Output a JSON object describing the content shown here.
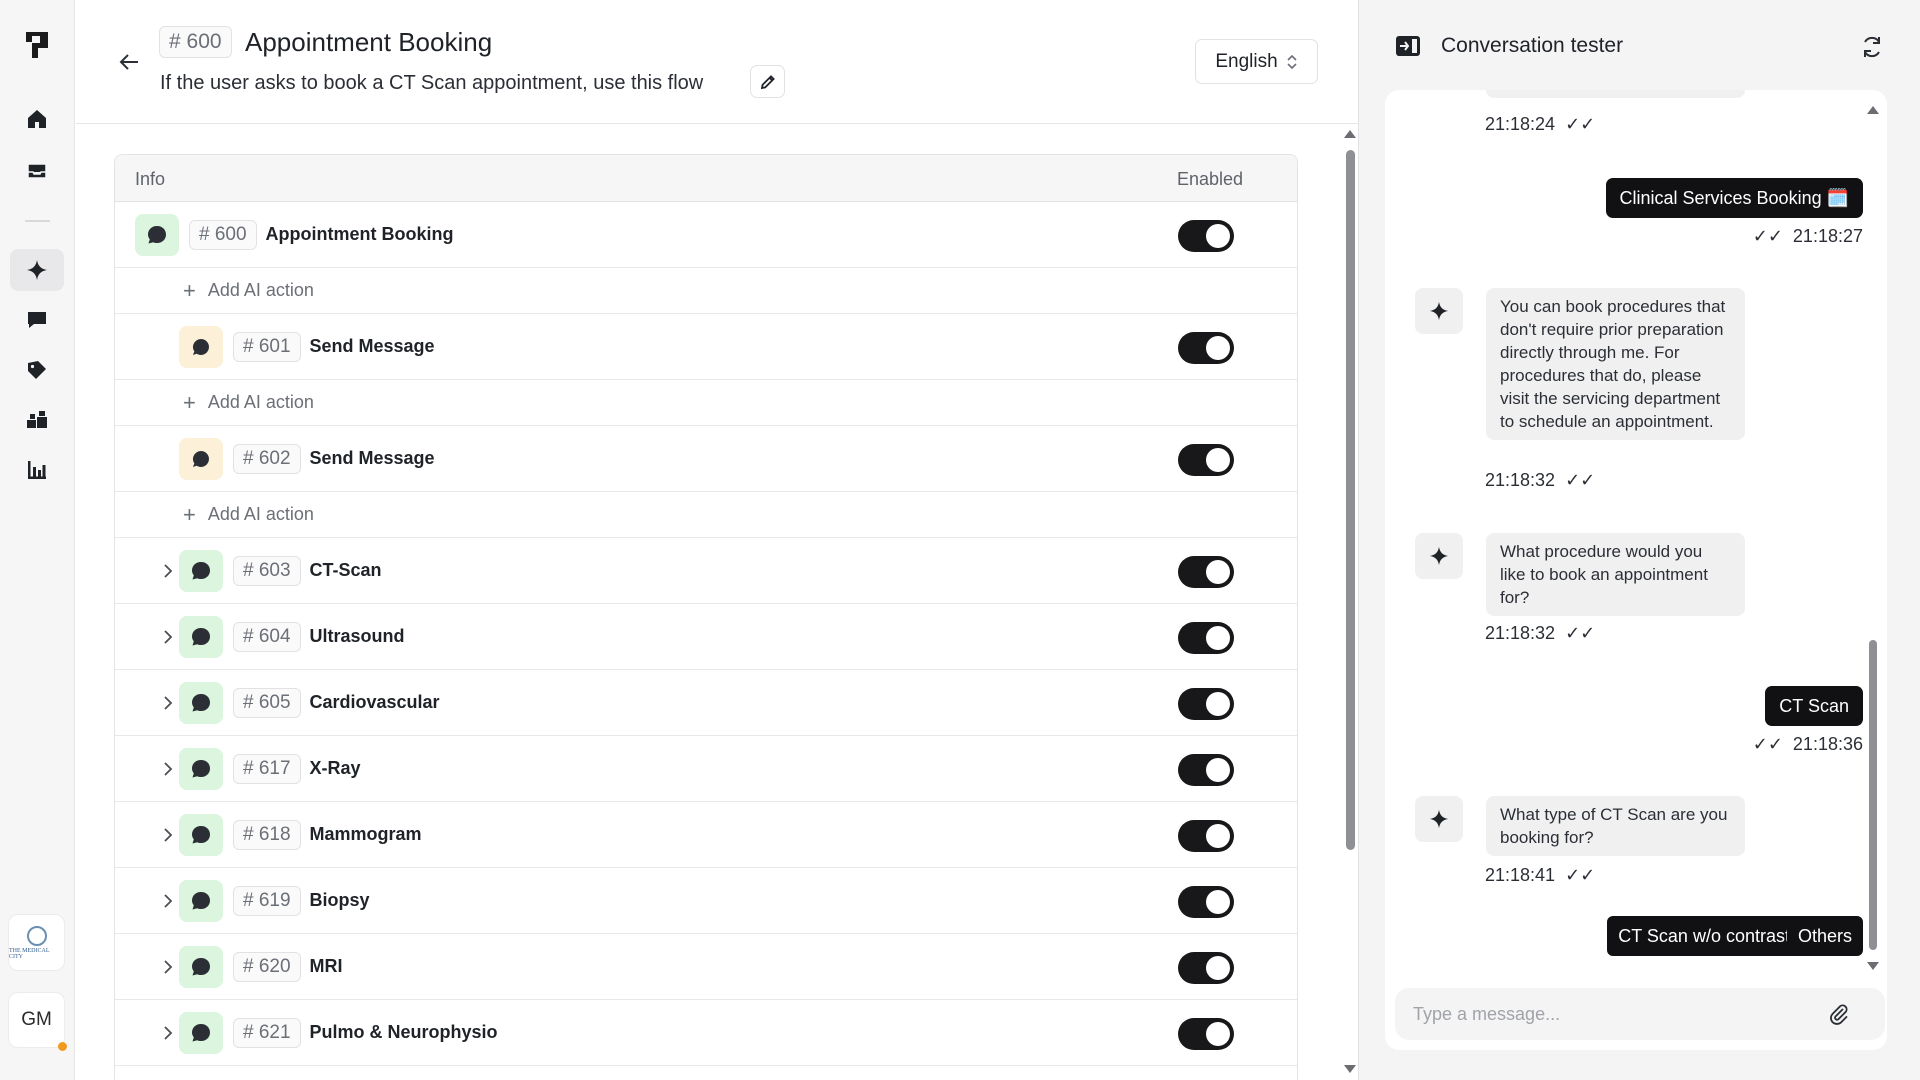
{
  "colors": {
    "accent": "#18181b",
    "green_tint": "#dcf5df",
    "amber_tint": "#fdf0d9",
    "status_dot": "#f29a1f"
  },
  "rail": {
    "items": [
      {
        "name": "home",
        "icon": "home-icon"
      },
      {
        "name": "inbox",
        "icon": "inbox-icon"
      },
      {
        "name": "ai-flows",
        "icon": "sparkle-icon",
        "active": true
      },
      {
        "name": "conversations",
        "icon": "chat-icon"
      },
      {
        "name": "tickets",
        "icon": "tag-icon"
      },
      {
        "name": "contacts",
        "icon": "users-icon"
      },
      {
        "name": "reports",
        "icon": "bar-chart-icon"
      }
    ],
    "org_label": "THE MEDICAL CITY",
    "avatar_initials": "GM"
  },
  "header": {
    "id": "# 600",
    "title": "Appointment Booking",
    "subtitle": "If the user asks to book a CT Scan appointment, use this flow",
    "language": "English"
  },
  "table": {
    "col_info": "Info",
    "col_enabled": "Enabled",
    "add_action_label": "Add AI action",
    "rows": [
      {
        "kind": "flow",
        "id": "# 600",
        "name": "Appointment Booking",
        "icon": "chat-bubble-icon",
        "tint": "green",
        "expandable": false,
        "indent": 0,
        "enabled": true
      },
      {
        "kind": "add"
      },
      {
        "kind": "flow",
        "id": "# 601",
        "name": "Send Message",
        "icon": "message-dot-icon",
        "tint": "amber",
        "expandable": false,
        "indent": 1,
        "enabled": true
      },
      {
        "kind": "add"
      },
      {
        "kind": "flow",
        "id": "# 602",
        "name": "Send Message",
        "icon": "message-dot-icon",
        "tint": "amber",
        "expandable": false,
        "indent": 1,
        "enabled": true
      },
      {
        "kind": "add"
      },
      {
        "kind": "flow",
        "id": "# 603",
        "name": "CT-Scan",
        "icon": "chat-bubble-icon",
        "tint": "green",
        "expandable": true,
        "indent": 1,
        "enabled": true
      },
      {
        "kind": "flow",
        "id": "# 604",
        "name": "Ultrasound",
        "icon": "chat-bubble-icon",
        "tint": "green",
        "expandable": true,
        "indent": 1,
        "enabled": true
      },
      {
        "kind": "flow",
        "id": "# 605",
        "name": "Cardiovascular",
        "icon": "chat-bubble-icon",
        "tint": "green",
        "expandable": true,
        "indent": 1,
        "enabled": true
      },
      {
        "kind": "flow",
        "id": "# 617",
        "name": "X-Ray",
        "icon": "chat-bubble-icon",
        "tint": "green",
        "expandable": true,
        "indent": 1,
        "enabled": true
      },
      {
        "kind": "flow",
        "id": "# 618",
        "name": "Mammogram",
        "icon": "chat-bubble-icon",
        "tint": "green",
        "expandable": true,
        "indent": 1,
        "enabled": true
      },
      {
        "kind": "flow",
        "id": "# 619",
        "name": "Biopsy",
        "icon": "chat-bubble-icon",
        "tint": "green",
        "expandable": true,
        "indent": 1,
        "enabled": true
      },
      {
        "kind": "flow",
        "id": "# 620",
        "name": "MRI",
        "icon": "chat-bubble-icon",
        "tint": "green",
        "expandable": true,
        "indent": 1,
        "enabled": true
      },
      {
        "kind": "flow",
        "id": "# 621",
        "name": "Pulmo & Neurophysio",
        "icon": "chat-bubble-icon",
        "tint": "green",
        "expandable": true,
        "indent": 1,
        "enabled": true
      }
    ]
  },
  "tester": {
    "title": "Conversation tester",
    "messages": [
      {
        "from": "bot",
        "time": "21:18:24"
      },
      {
        "from": "user",
        "text": "Clinical Services Booking 🗓️",
        "time": "21:18:27"
      },
      {
        "from": "bot",
        "text": "You can book procedures that don't require prior preparation directly through me. For procedures that do, please visit the servicing department to schedule an appointment.",
        "time": "21:18:32"
      },
      {
        "from": "bot",
        "text": "What procedure would you like to book an appointment for?",
        "time": "21:18:32"
      },
      {
        "from": "user",
        "text": "CT Scan",
        "time": "21:18:36"
      },
      {
        "from": "bot",
        "text": "What type of CT Scan are you booking for?",
        "time": "21:18:41"
      }
    ],
    "quick_replies": [
      "CT Scan w/o contrast",
      "Others"
    ],
    "input_placeholder": "Type a message..."
  }
}
